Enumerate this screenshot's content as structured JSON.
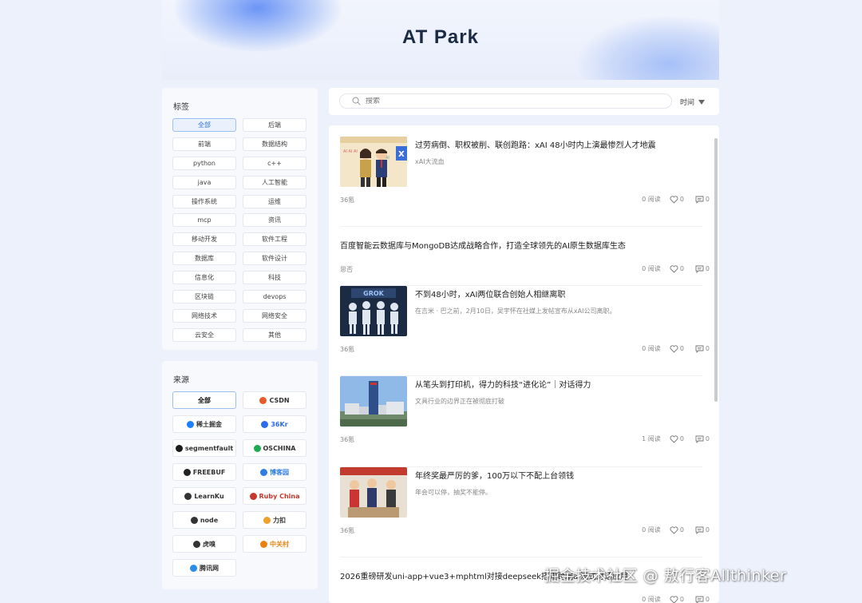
{
  "site": {
    "title": "AT Park"
  },
  "tags": {
    "title": "标签",
    "items": [
      "全部",
      "后端",
      "前端",
      "数据结构",
      "python",
      "c++",
      "java",
      "人工智能",
      "操作系统",
      "运维",
      "mcp",
      "资讯",
      "移动开发",
      "软件工程",
      "数据库",
      "软件设计",
      "信息化",
      "科技",
      "区块链",
      "devops",
      "网络技术",
      "网络安全",
      "云安全",
      "其他"
    ]
  },
  "sources": {
    "title": "来源",
    "items": [
      {
        "label": "全部",
        "icon": "all"
      },
      {
        "label": "CSDN",
        "icon": "csdn-logo"
      },
      {
        "label": "稀土掘金",
        "icon": "juejin-logo"
      },
      {
        "label": "36Kr",
        "icon": "36kr-logo"
      },
      {
        "label": "segmentfault",
        "icon": "segmentfault-logo"
      },
      {
        "label": "OSCHINA",
        "icon": "oschina-logo"
      },
      {
        "label": "FREEBUF",
        "icon": "freebuf-logo"
      },
      {
        "label": "博客园",
        "icon": "cnblogs-logo"
      },
      {
        "label": "LearnKu",
        "icon": "learnku-logo"
      },
      {
        "label": "Ruby China",
        "icon": "rubychina-logo"
      },
      {
        "label": "node",
        "icon": "nodejs-logo"
      },
      {
        "label": "力扣",
        "icon": "leetcode-logo"
      },
      {
        "label": "虎嗅",
        "icon": "huxiu-logo"
      },
      {
        "label": "中关村",
        "icon": "zol-logo"
      },
      {
        "label": "腾讯网",
        "icon": "qq-news-logo"
      }
    ]
  },
  "search": {
    "placeholder": "搜索",
    "sort_label": "时间"
  },
  "articles": [
    {
      "title": "过劳病倒、职权被削、联创跑路：xAI 48小时内上演最惨烈人才地震",
      "summary": "xAI大流血",
      "author": "36氪",
      "reads": "0 阅读",
      "likes": "0",
      "comments": "0",
      "thumb": "cartoon-people"
    },
    {
      "title": "百度智能云数据库与MongoDB达成战略合作，打造全球领先的AI原生数据库生态",
      "summary": "",
      "author": "思否",
      "reads": "0 阅读",
      "likes": "0",
      "comments": "0",
      "thumb": ""
    },
    {
      "title": "不到48小时，xAI两位联合创始人相继离职",
      "summary": "在吉米 · 巴之前，2月10日，吴宇怀在社媒上发帖宣布从xAI公司离职。",
      "author": "36氪",
      "reads": "0 阅读",
      "likes": "0",
      "comments": "0",
      "thumb": "robots",
      "thumb_text": "GROK"
    },
    {
      "title": "从笔头到打印机，得力的科技“进化论”｜对话得力",
      "summary": "文具行业的边界正在被彻底打破",
      "author": "36氪",
      "reads": "1 阅读",
      "likes": "0",
      "comments": "0",
      "thumb": "building"
    },
    {
      "title": "年终奖最严厉的爹，100万以下不配上台领钱",
      "summary": "年会可以停，抽奖不能停。",
      "author": "36氪",
      "reads": "0 阅读",
      "likes": "0",
      "comments": "0",
      "thumb": "cartoon-stage"
    },
    {
      "title": "2026重磅研发uni-app+vue3+mphtml对接deepseek搭建跨端ai流式对话应用",
      "summary": "",
      "author": "",
      "reads": "0 阅读",
      "likes": "0",
      "comments": "0",
      "thumb": ""
    }
  ],
  "watermark": "掘金技术社区 @ 敖行客Allthinker"
}
